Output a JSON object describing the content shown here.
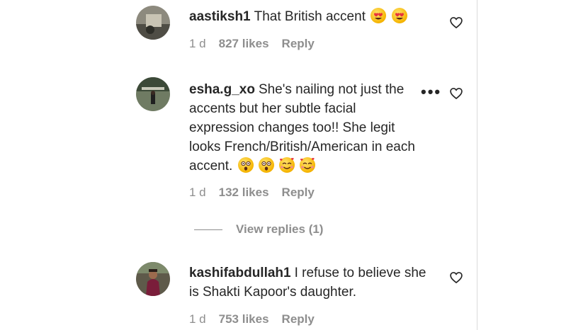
{
  "comments": [
    {
      "username": "aastiksh1",
      "text": "That British accent",
      "emojis": [
        "heart-eyes",
        "heart-eyes"
      ],
      "time": "1 d",
      "likes": "827 likes",
      "reply": "Reply"
    },
    {
      "username": "esha.g_xo",
      "text": "She's nailing not just the accents but her subtle facial expression changes too!! She legit looks French/British/American in each accent.",
      "emojis": [
        "astonished",
        "astonished",
        "smiling-hearts",
        "smiling-hearts"
      ],
      "time": "1 d",
      "likes": "132 likes",
      "reply": "Reply",
      "view_replies": "View replies (1)"
    },
    {
      "username": "kashifabdullah1",
      "text": "I refuse to believe she is Shakti Kapoor's daughter.",
      "emojis": [],
      "time": "1 d",
      "likes": "753 likes",
      "reply": "Reply"
    }
  ],
  "icons": {
    "like": "heart-outline-icon",
    "more": "more-options-icon"
  },
  "colors": {
    "text": "#262626",
    "muted": "#8e8e8e",
    "divider": "#dbdbdb"
  }
}
